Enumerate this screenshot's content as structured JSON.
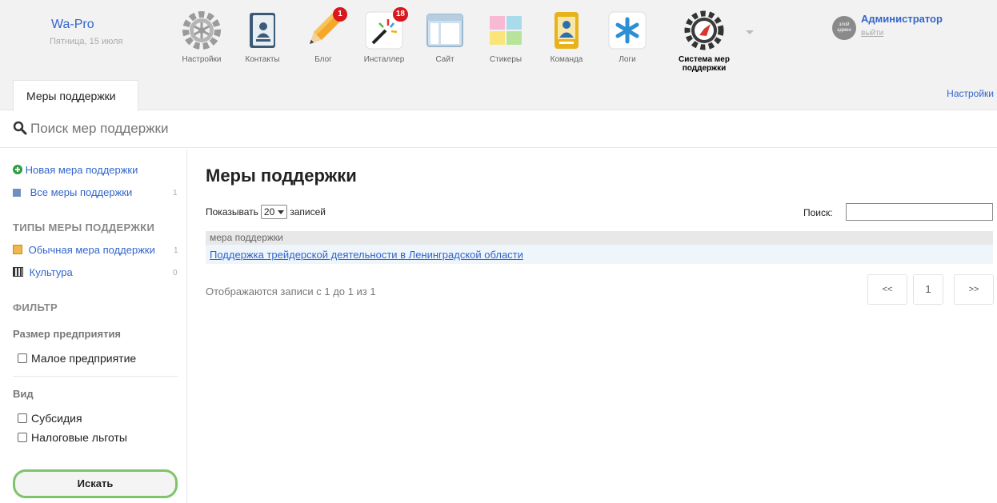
{
  "brand": {
    "name": "Wa-Pro",
    "date": "Пятница, 15 июля"
  },
  "apps": [
    {
      "label": "Настройки",
      "icon": "gear-icon"
    },
    {
      "label": "Контакты",
      "icon": "contacts-book-icon"
    },
    {
      "label": "Блог",
      "icon": "pencil-icon",
      "badge": "1"
    },
    {
      "label": "Инсталлер",
      "icon": "magic-wand-icon",
      "badge": "18"
    },
    {
      "label": "Сайт",
      "icon": "site-window-icon"
    },
    {
      "label": "Стикеры",
      "icon": "stickers-icon"
    },
    {
      "label": "Команда",
      "icon": "team-badge-icon"
    },
    {
      "label": "Логи",
      "icon": "asterisk-icon"
    },
    {
      "label": "Система мер поддержки",
      "icon": "compass-gear-icon",
      "active": true
    }
  ],
  "user": {
    "avatar_text": "злой админ",
    "name": "Администратор",
    "logout": "выйти"
  },
  "tab": {
    "label": "Меры поддержки"
  },
  "settings_link": "Настройки",
  "search": {
    "placeholder": "Поиск мер поддержки"
  },
  "sidebar": {
    "new_item": "Новая мера поддержки",
    "all_items": {
      "label": "Все меры поддержки",
      "count": "1"
    },
    "types_heading": "ТИПЫ МЕРЫ ПОДДЕРЖКИ",
    "types": [
      {
        "label": "Обычная мера поддержки",
        "count": "1"
      },
      {
        "label": "Культура",
        "count": "0"
      }
    ],
    "filter_heading": "ФИЛЬТР",
    "size_heading": "Размер предприятия",
    "size_options": [
      "Малое предприятие"
    ],
    "kind_heading": "Вид",
    "kind_options": [
      "Субсидия",
      "Налоговые льготы"
    ],
    "search_button": "Искать"
  },
  "main": {
    "title": "Меры поддержки",
    "show_prefix": "Показывать",
    "show_value": "20",
    "show_suffix": "записей",
    "filter_label": "Поиск:",
    "column_header": "мера поддержки",
    "rows": [
      "Поддержка трейдерской деятельности в Ленинградской области"
    ],
    "info": "Отображаются записи с 1 до 1 из 1",
    "pagination": {
      "prev": "<<",
      "page": "1",
      "next": ">>"
    }
  },
  "colors": {
    "link": "#3366cc",
    "badge": "#d8181e",
    "button_border": "#7ec46a",
    "row_highlight": "#eef5fb"
  }
}
